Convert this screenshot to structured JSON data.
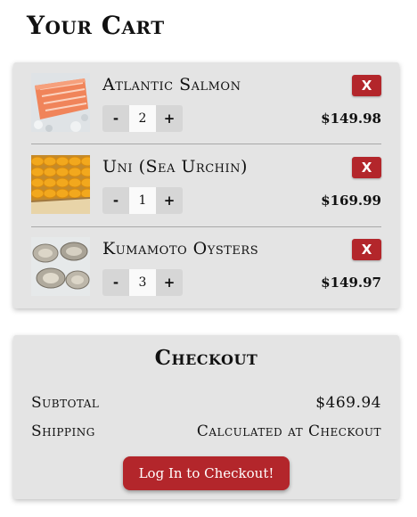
{
  "page": {
    "title": "Your Cart"
  },
  "cart": {
    "items": [
      {
        "name": "Atlantic Salmon",
        "quantity": "2",
        "price": "$149.98",
        "image_icon": "salmon-image",
        "remove_label": "X",
        "minus_label": "-",
        "plus_label": "+"
      },
      {
        "name": "Uni (Sea Urchin)",
        "quantity": "1",
        "price": "$169.99",
        "image_icon": "uni-image",
        "remove_label": "X",
        "minus_label": "-",
        "plus_label": "+"
      },
      {
        "name": "Kumamoto Oysters",
        "quantity": "3",
        "price": "$149.97",
        "image_icon": "oysters-image",
        "remove_label": "X",
        "minus_label": "-",
        "plus_label": "+"
      }
    ]
  },
  "checkout": {
    "title": "Checkout",
    "subtotal_label": "Subtotal",
    "subtotal_value": "$469.94",
    "shipping_label": "Shipping",
    "shipping_value": "Calculated at Checkout",
    "button_label": "Log In to Checkout!"
  },
  "colors": {
    "accent": "#b3262b",
    "panel": "#e4e4e4"
  }
}
